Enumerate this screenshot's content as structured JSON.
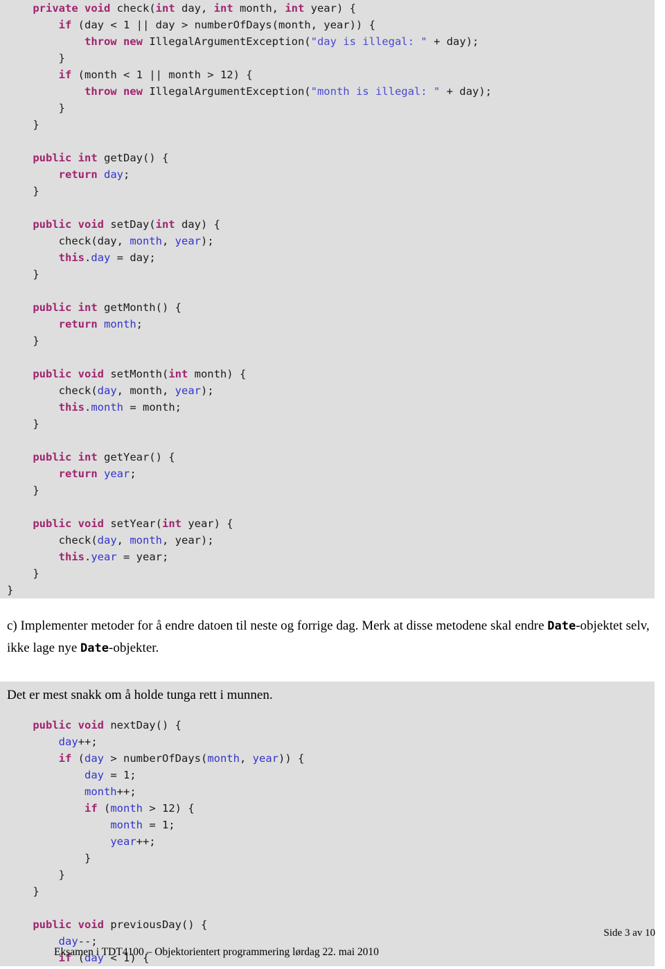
{
  "document": {
    "page_label": "Side 3 av 10",
    "footer_text": "Eksamen i TDT4100 – Objektorientert programmering lørdag 22. mai 2010"
  },
  "colors": {
    "code_background": "#dedede",
    "page_background": "#ffffff",
    "keyword": "#a0246e",
    "field": "#3333cc",
    "string": "#4a49d0",
    "plain_text": "#1a1a1a"
  },
  "code_block_1": {
    "lines": [
      [
        {
          "t": "    ",
          "c": "pln"
        },
        {
          "t": "private void ",
          "c": "kw"
        },
        {
          "t": "check(",
          "c": "pln"
        },
        {
          "t": "int",
          "c": "kw"
        },
        {
          "t": " day, ",
          "c": "pln"
        },
        {
          "t": "int",
          "c": "kw"
        },
        {
          "t": " month, ",
          "c": "pln"
        },
        {
          "t": "int",
          "c": "kw"
        },
        {
          "t": " year) {",
          "c": "pln"
        }
      ],
      [
        {
          "t": "        ",
          "c": "pln"
        },
        {
          "t": "if",
          "c": "kw"
        },
        {
          "t": " (day < 1 || day > numberOfDays(month, year)) {",
          "c": "pln"
        }
      ],
      [
        {
          "t": "            ",
          "c": "pln"
        },
        {
          "t": "throw new",
          "c": "kw"
        },
        {
          "t": " IllegalArgumentException(",
          "c": "pln"
        },
        {
          "t": "\"day is illegal: \"",
          "c": "str"
        },
        {
          "t": " + day);",
          "c": "pln"
        }
      ],
      [
        {
          "t": "        }",
          "c": "pln"
        }
      ],
      [
        {
          "t": "        ",
          "c": "pln"
        },
        {
          "t": "if",
          "c": "kw"
        },
        {
          "t": " (month < 1 || month > 12) {",
          "c": "pln"
        }
      ],
      [
        {
          "t": "            ",
          "c": "pln"
        },
        {
          "t": "throw new",
          "c": "kw"
        },
        {
          "t": " IllegalArgumentException(",
          "c": "pln"
        },
        {
          "t": "\"month is illegal: \"",
          "c": "str"
        },
        {
          "t": " + day);",
          "c": "pln"
        }
      ],
      [
        {
          "t": "        }",
          "c": "pln"
        }
      ],
      [
        {
          "t": "    }",
          "c": "pln"
        }
      ],
      [
        {
          "t": "",
          "c": "pln"
        }
      ],
      [
        {
          "t": "    ",
          "c": "pln"
        },
        {
          "t": "public int",
          "c": "kw"
        },
        {
          "t": " getDay() {",
          "c": "pln"
        }
      ],
      [
        {
          "t": "        ",
          "c": "pln"
        },
        {
          "t": "return",
          "c": "kw"
        },
        {
          "t": " ",
          "c": "pln"
        },
        {
          "t": "day",
          "c": "fld"
        },
        {
          "t": ";",
          "c": "pln"
        }
      ],
      [
        {
          "t": "    }",
          "c": "pln"
        }
      ],
      [
        {
          "t": "",
          "c": "pln"
        }
      ],
      [
        {
          "t": "    ",
          "c": "pln"
        },
        {
          "t": "public void",
          "c": "kw"
        },
        {
          "t": " setDay(",
          "c": "pln"
        },
        {
          "t": "int",
          "c": "kw"
        },
        {
          "t": " day) {",
          "c": "pln"
        }
      ],
      [
        {
          "t": "        check(day, ",
          "c": "pln"
        },
        {
          "t": "month",
          "c": "fld"
        },
        {
          "t": ", ",
          "c": "pln"
        },
        {
          "t": "year",
          "c": "fld"
        },
        {
          "t": ");",
          "c": "pln"
        }
      ],
      [
        {
          "t": "        ",
          "c": "pln"
        },
        {
          "t": "this",
          "c": "kw"
        },
        {
          "t": ".",
          "c": "pln"
        },
        {
          "t": "day",
          "c": "fld"
        },
        {
          "t": " = day;",
          "c": "pln"
        }
      ],
      [
        {
          "t": "    }",
          "c": "pln"
        }
      ],
      [
        {
          "t": "",
          "c": "pln"
        }
      ],
      [
        {
          "t": "    ",
          "c": "pln"
        },
        {
          "t": "public int",
          "c": "kw"
        },
        {
          "t": " getMonth() {",
          "c": "pln"
        }
      ],
      [
        {
          "t": "        ",
          "c": "pln"
        },
        {
          "t": "return",
          "c": "kw"
        },
        {
          "t": " ",
          "c": "pln"
        },
        {
          "t": "month",
          "c": "fld"
        },
        {
          "t": ";",
          "c": "pln"
        }
      ],
      [
        {
          "t": "    }",
          "c": "pln"
        }
      ],
      [
        {
          "t": "",
          "c": "pln"
        }
      ],
      [
        {
          "t": "    ",
          "c": "pln"
        },
        {
          "t": "public void",
          "c": "kw"
        },
        {
          "t": " setMonth(",
          "c": "pln"
        },
        {
          "t": "int",
          "c": "kw"
        },
        {
          "t": " month) {",
          "c": "pln"
        }
      ],
      [
        {
          "t": "        check(",
          "c": "pln"
        },
        {
          "t": "day",
          "c": "fld"
        },
        {
          "t": ", month, ",
          "c": "pln"
        },
        {
          "t": "year",
          "c": "fld"
        },
        {
          "t": ");",
          "c": "pln"
        }
      ],
      [
        {
          "t": "        ",
          "c": "pln"
        },
        {
          "t": "this",
          "c": "kw"
        },
        {
          "t": ".",
          "c": "pln"
        },
        {
          "t": "month",
          "c": "fld"
        },
        {
          "t": " = month;",
          "c": "pln"
        }
      ],
      [
        {
          "t": "    }",
          "c": "pln"
        }
      ],
      [
        {
          "t": "",
          "c": "pln"
        }
      ],
      [
        {
          "t": "    ",
          "c": "pln"
        },
        {
          "t": "public int",
          "c": "kw"
        },
        {
          "t": " getYear() {",
          "c": "pln"
        }
      ],
      [
        {
          "t": "        ",
          "c": "pln"
        },
        {
          "t": "return",
          "c": "kw"
        },
        {
          "t": " ",
          "c": "pln"
        },
        {
          "t": "year",
          "c": "fld"
        },
        {
          "t": ";",
          "c": "pln"
        }
      ],
      [
        {
          "t": "    }",
          "c": "pln"
        }
      ],
      [
        {
          "t": "",
          "c": "pln"
        }
      ],
      [
        {
          "t": "    ",
          "c": "pln"
        },
        {
          "t": "public void",
          "c": "kw"
        },
        {
          "t": " setYear(",
          "c": "pln"
        },
        {
          "t": "int",
          "c": "kw"
        },
        {
          "t": " year) {",
          "c": "pln"
        }
      ],
      [
        {
          "t": "        check(",
          "c": "pln"
        },
        {
          "t": "day",
          "c": "fld"
        },
        {
          "t": ", ",
          "c": "pln"
        },
        {
          "t": "month",
          "c": "fld"
        },
        {
          "t": ", year);",
          "c": "pln"
        }
      ],
      [
        {
          "t": "        ",
          "c": "pln"
        },
        {
          "t": "this",
          "c": "kw"
        },
        {
          "t": ".",
          "c": "pln"
        },
        {
          "t": "year",
          "c": "fld"
        },
        {
          "t": " = year;",
          "c": "pln"
        }
      ],
      [
        {
          "t": "    }",
          "c": "pln"
        }
      ],
      [
        {
          "t": "}",
          "c": "pln"
        }
      ]
    ]
  },
  "task_c": {
    "paragraph_1_part_a": "c) Implementer metoder for å endre datoen til neste og forrige dag. Merk at disse metodene skal endre ",
    "mono_1": "Date",
    "paragraph_1_part_b": "-objektet selv, ikke lage nye ",
    "mono_2": "Date",
    "paragraph_1_part_c": "-objekter."
  },
  "answer_note": {
    "text": "Det er mest snakk om å holde tunga rett i munnen."
  },
  "code_block_2": {
    "lines": [
      [
        {
          "t": "    ",
          "c": "pln"
        },
        {
          "t": "public void",
          "c": "kw"
        },
        {
          "t": " nextDay() {",
          "c": "pln"
        }
      ],
      [
        {
          "t": "        ",
          "c": "pln"
        },
        {
          "t": "day",
          "c": "fld"
        },
        {
          "t": "++;",
          "c": "pln"
        }
      ],
      [
        {
          "t": "        ",
          "c": "pln"
        },
        {
          "t": "if",
          "c": "kw"
        },
        {
          "t": " (",
          "c": "pln"
        },
        {
          "t": "day",
          "c": "fld"
        },
        {
          "t": " > numberOfDays(",
          "c": "pln"
        },
        {
          "t": "month",
          "c": "fld"
        },
        {
          "t": ", ",
          "c": "pln"
        },
        {
          "t": "year",
          "c": "fld"
        },
        {
          "t": ")) {",
          "c": "pln"
        }
      ],
      [
        {
          "t": "            ",
          "c": "pln"
        },
        {
          "t": "day",
          "c": "fld"
        },
        {
          "t": " = 1;",
          "c": "pln"
        }
      ],
      [
        {
          "t": "            ",
          "c": "pln"
        },
        {
          "t": "month",
          "c": "fld"
        },
        {
          "t": "++;",
          "c": "pln"
        }
      ],
      [
        {
          "t": "            ",
          "c": "pln"
        },
        {
          "t": "if",
          "c": "kw"
        },
        {
          "t": " (",
          "c": "pln"
        },
        {
          "t": "month",
          "c": "fld"
        },
        {
          "t": " > 12) {",
          "c": "pln"
        }
      ],
      [
        {
          "t": "                ",
          "c": "pln"
        },
        {
          "t": "month",
          "c": "fld"
        },
        {
          "t": " = 1;",
          "c": "pln"
        }
      ],
      [
        {
          "t": "                ",
          "c": "pln"
        },
        {
          "t": "year",
          "c": "fld"
        },
        {
          "t": "++;",
          "c": "pln"
        }
      ],
      [
        {
          "t": "            }",
          "c": "pln"
        }
      ],
      [
        {
          "t": "        }",
          "c": "pln"
        }
      ],
      [
        {
          "t": "    }",
          "c": "pln"
        }
      ],
      [
        {
          "t": "",
          "c": "pln"
        }
      ],
      [
        {
          "t": "    ",
          "c": "pln"
        },
        {
          "t": "public void",
          "c": "kw"
        },
        {
          "t": " previousDay() {",
          "c": "pln"
        }
      ],
      [
        {
          "t": "        ",
          "c": "pln"
        },
        {
          "t": "day",
          "c": "fld"
        },
        {
          "t": "--;",
          "c": "pln"
        }
      ],
      [
        {
          "t": "        ",
          "c": "pln"
        },
        {
          "t": "if",
          "c": "kw"
        },
        {
          "t": " (",
          "c": "pln"
        },
        {
          "t": "day",
          "c": "fld"
        },
        {
          "t": " < 1) {",
          "c": "pln"
        }
      ]
    ]
  }
}
